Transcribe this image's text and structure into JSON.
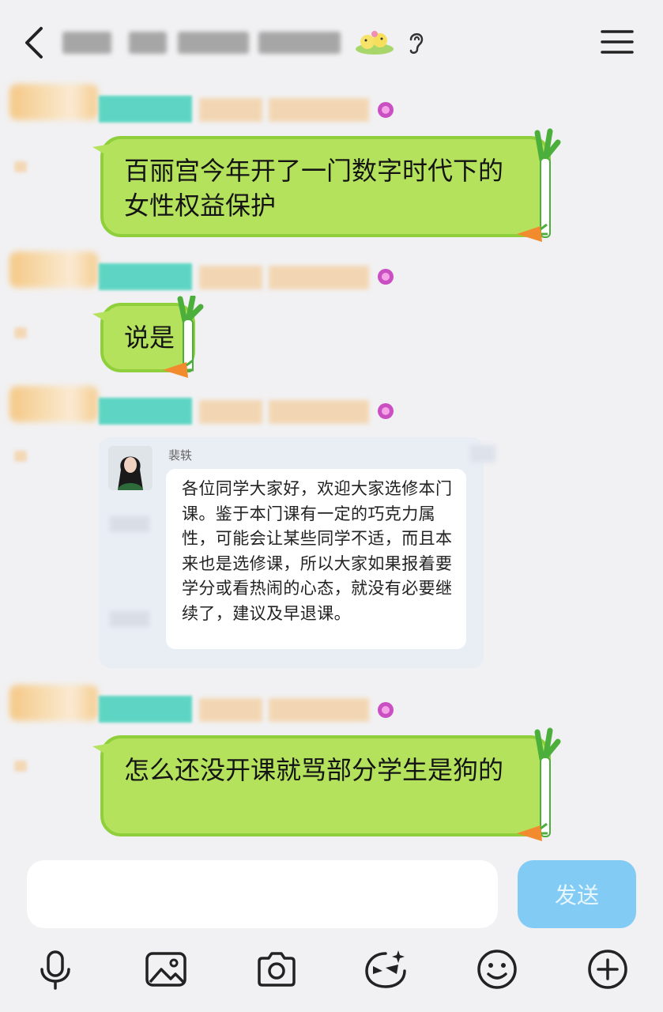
{
  "colors": {
    "background": "#f1f1f3",
    "bubble_green": "#b4e25d",
    "bubble_border": "#8fcf3b",
    "send_button": "#82cbf5"
  },
  "header": {
    "back_icon": "chevron-left-icon",
    "menu_icon": "hamburger-menu-icon",
    "ear_icon": "ear-icon"
  },
  "messages": [
    {
      "text": "百丽宫今年开了一门数字时代下的女性权益保护"
    },
    {
      "text": "说是"
    },
    {
      "forwarded_card": {
        "sender": "裴轶",
        "text": "各位同学大家好，欢迎大家选修本门课。鉴于本门课有一定的巧克力属性，可能会让某些同学不适，而且本来也是选修课，所以大家如果报着要学分或看热闹的心态，就没有必要继续了，建议及早退课。"
      }
    },
    {
      "text": "怎么还没开课就骂部分学生是狗的"
    }
  ],
  "input": {
    "value": "",
    "send_label": "发送"
  },
  "toolbar": {
    "icons": [
      "microphone-icon",
      "image-icon",
      "camera-icon",
      "sticker-icon",
      "emoji-icon",
      "plus-icon"
    ]
  }
}
